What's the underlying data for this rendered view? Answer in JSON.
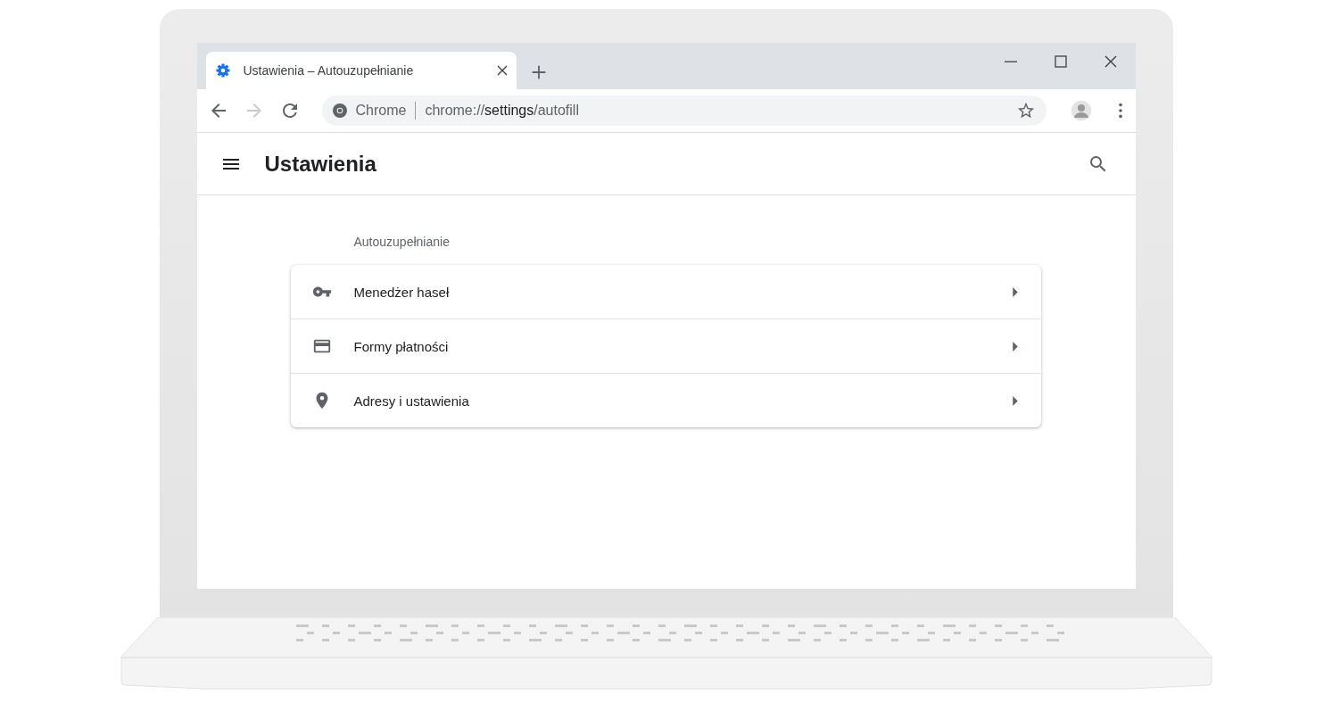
{
  "browser": {
    "tabs": [
      {
        "title": "Ustawienia – Autouzupełnianie",
        "selected": true
      }
    ],
    "toolbar": [
      {
        "kind": "back",
        "disabled": false
      },
      {
        "kind": "forward",
        "disabled": true
      },
      {
        "kind": "reload",
        "disabled": false
      }
    ],
    "omnibox": {
      "site": "Chrome",
      "url": "chrome://**settings**/autofill"
    }
  },
  "page": {
    "title": "Ustawienia",
    "section": "Autouzupełnianie",
    "items": [
      {
        "kind": "key",
        "label": "Menedżer haseł"
      },
      {
        "kind": "card",
        "label": "Formy płatności"
      },
      {
        "kind": "pin",
        "label": "Adresy i ustawienia"
      }
    ]
  }
}
